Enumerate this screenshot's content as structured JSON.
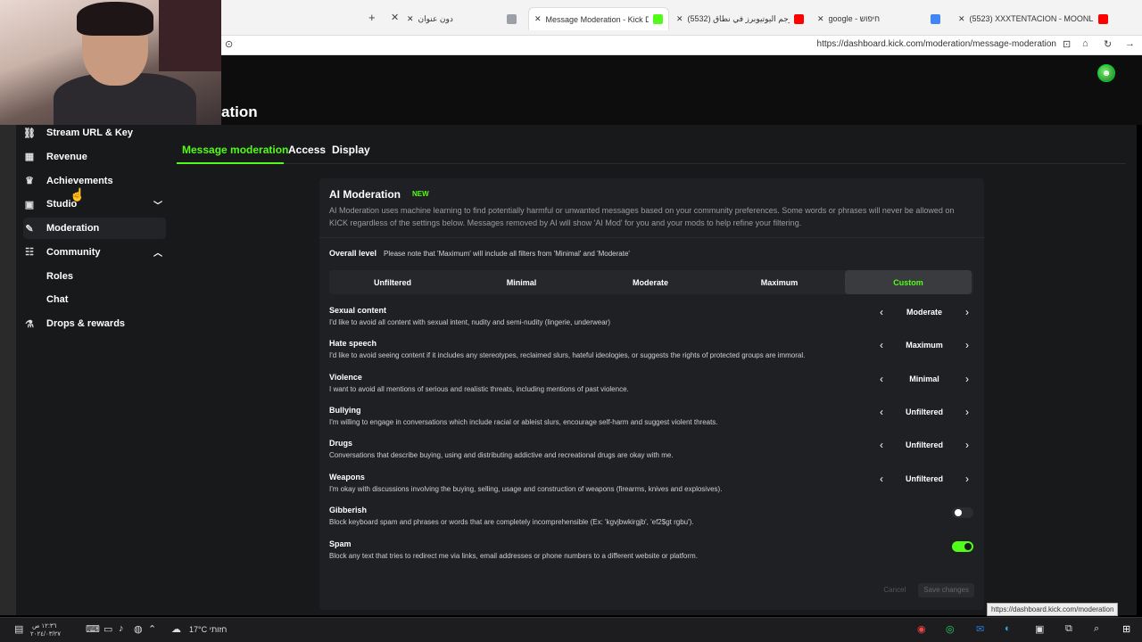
{
  "browser": {
    "tabs": [
      {
        "title": "دون عنوان",
        "active": false,
        "icon": "drive-icon",
        "color": "#9aa0a6"
      },
      {
        "title": "Message Moderation - Kick Dashb",
        "active": true,
        "icon": "kick-icon",
        "color": "#53fc18"
      },
      {
        "title": "(5532) كيف تترجم اليوتيوبرز في نطاق",
        "active": false,
        "icon": "youtube-icon",
        "color": "#ff0000"
      },
      {
        "title": "google - חיפוש",
        "active": false,
        "icon": "google-icon",
        "color": "#4285f4"
      },
      {
        "title": "(5523) XXXTENTACION - MOONLI",
        "active": false,
        "icon": "youtube-icon",
        "color": "#ff0000"
      }
    ],
    "url": "https://dashboard.kick.com/moderation/message-moderation"
  },
  "page": {
    "title": "ation"
  },
  "sidebar": {
    "items": [
      {
        "label": "Stream URL & Key",
        "icon": "link-icon"
      },
      {
        "label": "Revenue",
        "icon": "chart-icon"
      },
      {
        "label": "Achievements",
        "icon": "trophy-icon"
      },
      {
        "label": "Studio",
        "icon": "studio-icon",
        "expand": "down"
      },
      {
        "label": "Moderation",
        "icon": "wrench-icon",
        "selected": true
      },
      {
        "label": "Community",
        "icon": "community-icon",
        "expand": "up"
      },
      {
        "label": "Roles",
        "sub": true
      },
      {
        "label": "Chat",
        "sub": true
      },
      {
        "label": "Drops & rewards",
        "icon": "gift-icon"
      }
    ]
  },
  "tabs": [
    "Message moderation",
    "Access",
    "Display"
  ],
  "ai": {
    "title": "AI Moderation",
    "badge": "NEW",
    "description": "AI Moderation uses machine learning to find potentially harmful or unwanted messages based on your community preferences. Some words or phrases will never be allowed on KICK regardless of the settings below. Messages removed by AI will show 'AI Mod' for you and your mods to help refine your filtering.",
    "overall_label": "Overall level",
    "overall_note": "Please note that 'Maximum' will include all filters from 'Minimal' and 'Moderate'",
    "levels": [
      "Unfiltered",
      "Minimal",
      "Moderate",
      "Maximum",
      "Custom"
    ],
    "selected_level": "Custom",
    "categories": [
      {
        "title": "Sexual content",
        "desc": "I'd like to avoid all content with sexual intent, nudity and semi-nudity (lingerie, underwear)",
        "value": "Moderate"
      },
      {
        "title": "Hate speech",
        "desc": "I'd like to avoid seeing content if it includes any stereotypes, reclaimed slurs, hateful ideologies, or suggests the rights of protected groups are immoral.",
        "value": "Maximum"
      },
      {
        "title": "Violence",
        "desc": "I want to avoid all mentions of serious and realistic threats, including mentions of past violence.",
        "value": "Minimal"
      },
      {
        "title": "Bullying",
        "desc": "I'm willing to engage in conversations which include racial or ableist slurs, encourage self-harm and suggest violent threats.",
        "value": "Unfiltered"
      },
      {
        "title": "Drugs",
        "desc": "Conversations that describe buying, using and distributing addictive and recreational drugs are okay with me.",
        "value": "Unfiltered"
      },
      {
        "title": "Weapons",
        "desc": "I'm okay with discussions involving the buying, selling, usage and construction of weapons (firearms, knives and explosives).",
        "value": "Unfiltered"
      }
    ],
    "toggles": [
      {
        "title": "Gibberish",
        "desc": "Block keyboard spam and phrases or words that are completely incomprehensible (Ex: 'kgvjbwkirgjb', 'ef2$gt rgbu').",
        "on": false
      },
      {
        "title": "Spam",
        "desc": "Block any text that tries to redirect me via links, email addresses or phone numbers to a different website or platform.",
        "on": true
      }
    ],
    "cancel_label": "Cancel",
    "save_label": "Save changes"
  },
  "status_tooltip": "https://dashboard.kick.com/moderation",
  "taskbar": {
    "weather": "17°C חזותי",
    "date": "٢٠٢٤/٠٣/٢٧",
    "time": "١٢:٣٦ ص"
  },
  "colors": {
    "accent": "#53fc18",
    "bg": "#18191b",
    "card": "#1f2023"
  }
}
